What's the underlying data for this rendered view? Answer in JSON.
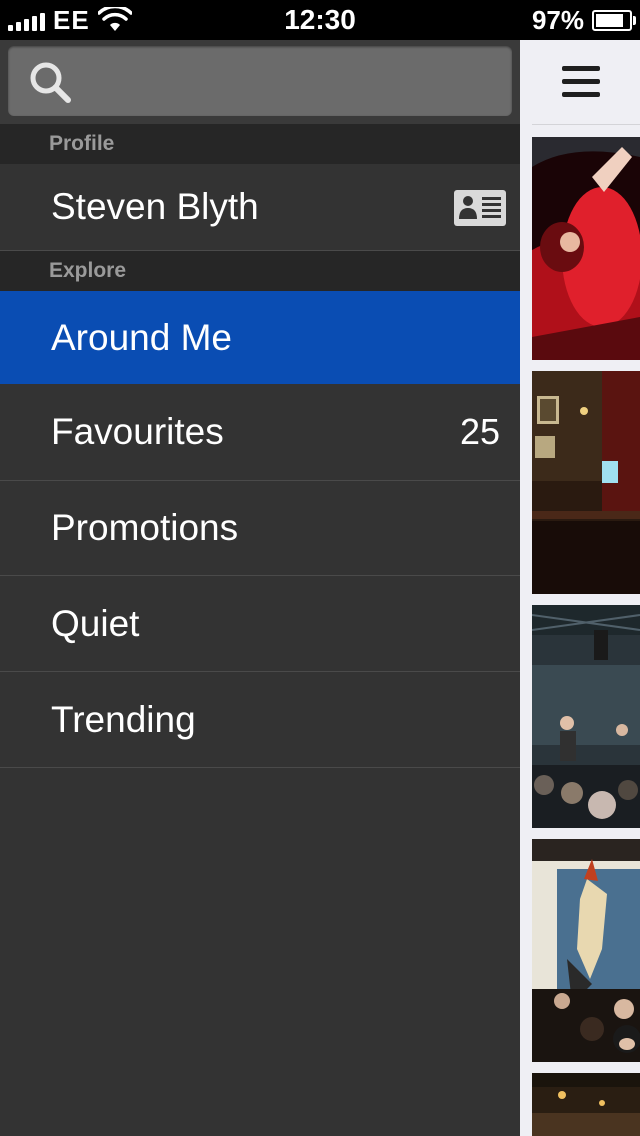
{
  "status_bar": {
    "carrier": "EE",
    "time": "12:30",
    "battery_percent": "97%",
    "battery_level": 0.97,
    "signal_bars": 5
  },
  "drawer": {
    "search": {
      "placeholder": "",
      "value": ""
    },
    "profile_header": "Profile",
    "profile_name": "Steven Blyth",
    "explore_header": "Explore",
    "items": [
      {
        "label": "Around Me",
        "badge": "",
        "active": true
      },
      {
        "label": "Favourites",
        "badge": "25",
        "active": false
      },
      {
        "label": "Promotions",
        "badge": "",
        "active": false
      },
      {
        "label": "Quiet",
        "badge": "",
        "active": false
      },
      {
        "label": "Trending",
        "badge": "",
        "active": false
      }
    ]
  },
  "content": {
    "photos": [
      {
        "name": "venue-photo-nightclub"
      },
      {
        "name": "venue-photo-pub-interior"
      },
      {
        "name": "venue-photo-live-music"
      },
      {
        "name": "venue-photo-mural-bar"
      },
      {
        "name": "venue-photo-partial"
      }
    ]
  },
  "colors": {
    "drawer_bg": "#333333",
    "section_header_bg": "#262626",
    "active_item": "#0a4db3",
    "content_bg": "#efeff4"
  }
}
